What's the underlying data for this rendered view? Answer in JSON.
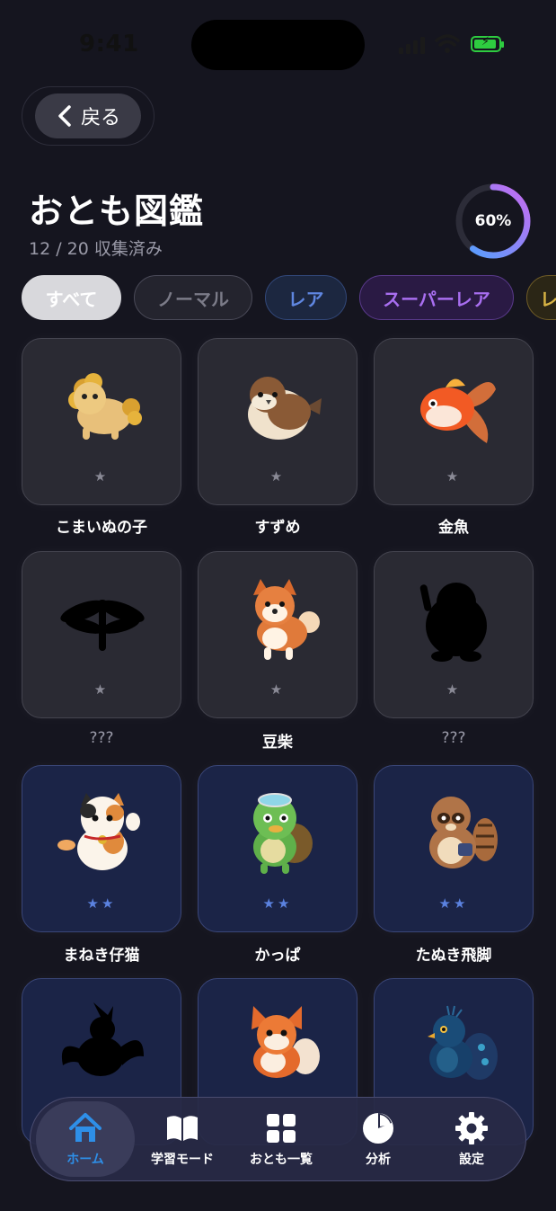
{
  "status": {
    "time": "9:41"
  },
  "header": {
    "back_label": "戻る",
    "title": "おとも図鑑",
    "subtitle": "12 / 20 収集済み",
    "progress_text": "60%",
    "progress_value": 0.6
  },
  "filters": [
    {
      "label": "すべて"
    },
    {
      "label": "ノーマル"
    },
    {
      "label": "レア"
    },
    {
      "label": "スーパーレア"
    },
    {
      "label": "レ"
    }
  ],
  "collection": [
    {
      "name": "こまいぬの子",
      "stars": "★",
      "rarity": "normal",
      "icon": "komainu-icon"
    },
    {
      "name": "すずめ",
      "stars": "★",
      "rarity": "normal",
      "icon": "sparrow-icon"
    },
    {
      "name": "金魚",
      "stars": "★",
      "rarity": "normal",
      "icon": "goldfish-icon"
    },
    {
      "name": "???",
      "stars": "★",
      "rarity": "normal",
      "icon": "dragonfly-silhouette-icon"
    },
    {
      "name": "豆柴",
      "stars": "★",
      "rarity": "normal",
      "icon": "shiba-icon"
    },
    {
      "name": "???",
      "stars": "★",
      "rarity": "normal",
      "icon": "penguin-silhouette-icon"
    },
    {
      "name": "まねき仔猫",
      "stars": "★★",
      "rarity": "rare",
      "icon": "maneki-cat-icon"
    },
    {
      "name": "かっぱ",
      "stars": "★★",
      "rarity": "rare",
      "icon": "kappa-icon"
    },
    {
      "name": "たぬき飛脚",
      "stars": "★★",
      "rarity": "rare",
      "icon": "tanuki-icon"
    },
    {
      "name": "",
      "stars": "",
      "rarity": "rare",
      "icon": "bird-silhouette-icon"
    },
    {
      "name": "",
      "stars": "",
      "rarity": "rare",
      "icon": "fox-icon"
    },
    {
      "name": "",
      "stars": "",
      "rarity": "rare",
      "icon": "peacock-icon"
    }
  ],
  "tabbar": [
    {
      "label": "ホーム",
      "icon": "home-icon"
    },
    {
      "label": "学習モード",
      "icon": "book-icon"
    },
    {
      "label": "おとも一覧",
      "icon": "grid-icon"
    },
    {
      "label": "分析",
      "icon": "pie-chart-icon"
    },
    {
      "label": "設定",
      "icon": "gear-icon"
    }
  ],
  "colors": {
    "background": "#15151f",
    "accent_blue": "#2e8fe8",
    "rare_blue": "#5b82e0",
    "super_rare_purple": "#a86ef0",
    "legend_gold": "#d7b344",
    "battery_green": "#2ecc40"
  }
}
